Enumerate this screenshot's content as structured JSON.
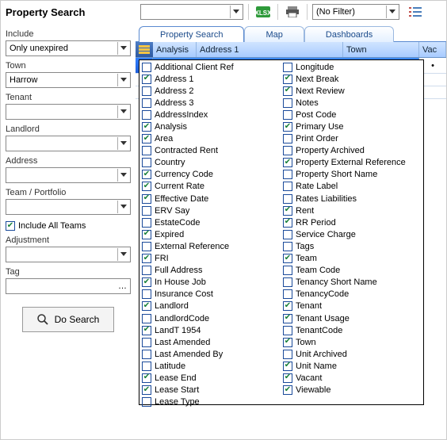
{
  "title": "Property Search",
  "top": {
    "quick": "",
    "filter": "(No Filter)"
  },
  "sidebar": {
    "include_label": "Include",
    "include_value": "Only unexpired",
    "town_label": "Town",
    "town_value": "Harrow",
    "tenant_label": "Tenant",
    "tenant_value": "",
    "landlord_label": "Landlord",
    "landlord_value": "",
    "address_label": "Address",
    "address_value": "",
    "team_label": "Team / Portfolio",
    "team_value": "",
    "all_teams_label": "Include All Teams",
    "all_teams_checked": true,
    "adjustment_label": "Adjustment",
    "adjustment_value": "",
    "tag_label": "Tag",
    "tag_value": "",
    "search_btn": "Do Search"
  },
  "tabs": [
    "Property Search",
    "Map",
    "Dashboards"
  ],
  "active_tab": 0,
  "grid_headers": [
    "Analysis",
    "Address 1",
    "Town",
    "Vac"
  ],
  "grid_right_char": "•",
  "columns_left": [
    {
      "label": "Additional Client Ref",
      "checked": false
    },
    {
      "label": "Address 1",
      "checked": true
    },
    {
      "label": "Address 2",
      "checked": false
    },
    {
      "label": "Address 3",
      "checked": false
    },
    {
      "label": "AddressIndex",
      "checked": false
    },
    {
      "label": "Analysis",
      "checked": true
    },
    {
      "label": "Area",
      "checked": true
    },
    {
      "label": "Contracted Rent",
      "checked": false
    },
    {
      "label": "Country",
      "checked": false
    },
    {
      "label": "Currency Code",
      "checked": true
    },
    {
      "label": "Current Rate",
      "checked": true
    },
    {
      "label": "Effective Date",
      "checked": true
    },
    {
      "label": "ERV Say",
      "checked": false
    },
    {
      "label": "EstateCode",
      "checked": false
    },
    {
      "label": "Expired",
      "checked": true
    },
    {
      "label": "External Reference",
      "checked": false
    },
    {
      "label": "FRI",
      "checked": true
    },
    {
      "label": "Full Address",
      "checked": false
    },
    {
      "label": "In House Job",
      "checked": true
    },
    {
      "label": "Insurance Cost",
      "checked": false
    },
    {
      "label": "Landlord",
      "checked": true
    },
    {
      "label": "LandlordCode",
      "checked": false
    },
    {
      "label": "LandT 1954",
      "checked": true
    },
    {
      "label": "Last Amended",
      "checked": false
    },
    {
      "label": "Last Amended By",
      "checked": false
    },
    {
      "label": "Latitude",
      "checked": false
    },
    {
      "label": "Lease End",
      "checked": true
    },
    {
      "label": "Lease Start",
      "checked": true
    },
    {
      "label": "Lease Type",
      "checked": false
    }
  ],
  "columns_right": [
    {
      "label": "Longitude",
      "checked": false
    },
    {
      "label": "Next Break",
      "checked": true
    },
    {
      "label": "Next Review",
      "checked": true
    },
    {
      "label": "Notes",
      "checked": false
    },
    {
      "label": "Post Code",
      "checked": false
    },
    {
      "label": "Primary Use",
      "checked": true
    },
    {
      "label": "Print Order",
      "checked": false
    },
    {
      "label": "Property Archived",
      "checked": false
    },
    {
      "label": "Property External Reference",
      "checked": true
    },
    {
      "label": "Property Short Name",
      "checked": false
    },
    {
      "label": "Rate Label",
      "checked": false
    },
    {
      "label": "Rates Liabilities",
      "checked": false
    },
    {
      "label": "Rent",
      "checked": true
    },
    {
      "label": "RR Period",
      "checked": true
    },
    {
      "label": "Service Charge",
      "checked": false
    },
    {
      "label": "Tags",
      "checked": false
    },
    {
      "label": "Team",
      "checked": true
    },
    {
      "label": "Team Code",
      "checked": false
    },
    {
      "label": "Tenancy Short Name",
      "checked": false
    },
    {
      "label": "TenancyCode",
      "checked": false
    },
    {
      "label": "Tenant",
      "checked": true
    },
    {
      "label": "Tenant Usage",
      "checked": true
    },
    {
      "label": "TenantCode",
      "checked": false
    },
    {
      "label": "Town",
      "checked": true
    },
    {
      "label": "Unit Archived",
      "checked": false
    },
    {
      "label": "Unit Name",
      "checked": true
    },
    {
      "label": "Vacant",
      "checked": true
    },
    {
      "label": "Viewable",
      "checked": true
    }
  ]
}
